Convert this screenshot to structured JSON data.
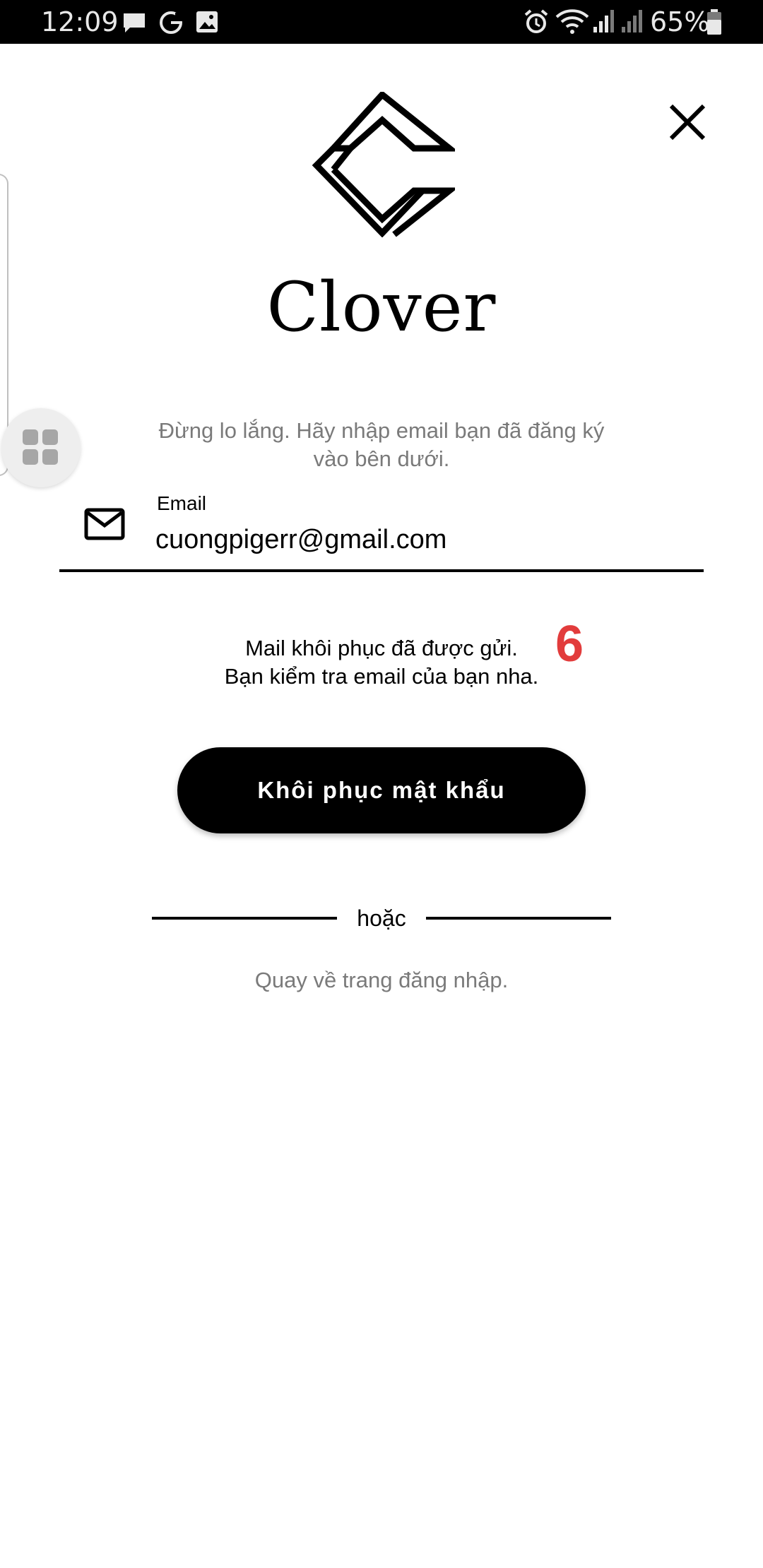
{
  "status_bar": {
    "time": "12:09",
    "battery_percent": "65%",
    "icons": [
      "message-icon",
      "g-icon",
      "image-icon",
      "alarm-icon",
      "wifi-icon",
      "signal-icon",
      "signal-icon",
      "battery-icon"
    ]
  },
  "header": {
    "close_icon": "close-icon",
    "logo_icon": "clover-logo-icon",
    "brand_name": "Clover"
  },
  "form": {
    "instruction": "Đừng lo lắng. Hãy nhập email bạn đã đăng ký vào bên dưới.",
    "email_label": "Email",
    "email_value": "cuongpigerr@gmail.com",
    "email_icon": "mail-icon"
  },
  "result": {
    "message_line1": "Mail khôi phục đã được gửi.",
    "message_line2": "Bạn kiểm tra email của bạn nha.",
    "annotation": "6"
  },
  "actions": {
    "recover_label": "Khôi phục mật khẩu",
    "divider_text": "hoặc",
    "back_to_login": "Quay về trang đăng nhập."
  },
  "overlay": {
    "floating_button_icon": "apps-grid-icon"
  },
  "colors": {
    "primary": "#000000",
    "background": "#ffffff",
    "muted_text": "#7a7a7a",
    "annotation": "#e23c3c"
  }
}
